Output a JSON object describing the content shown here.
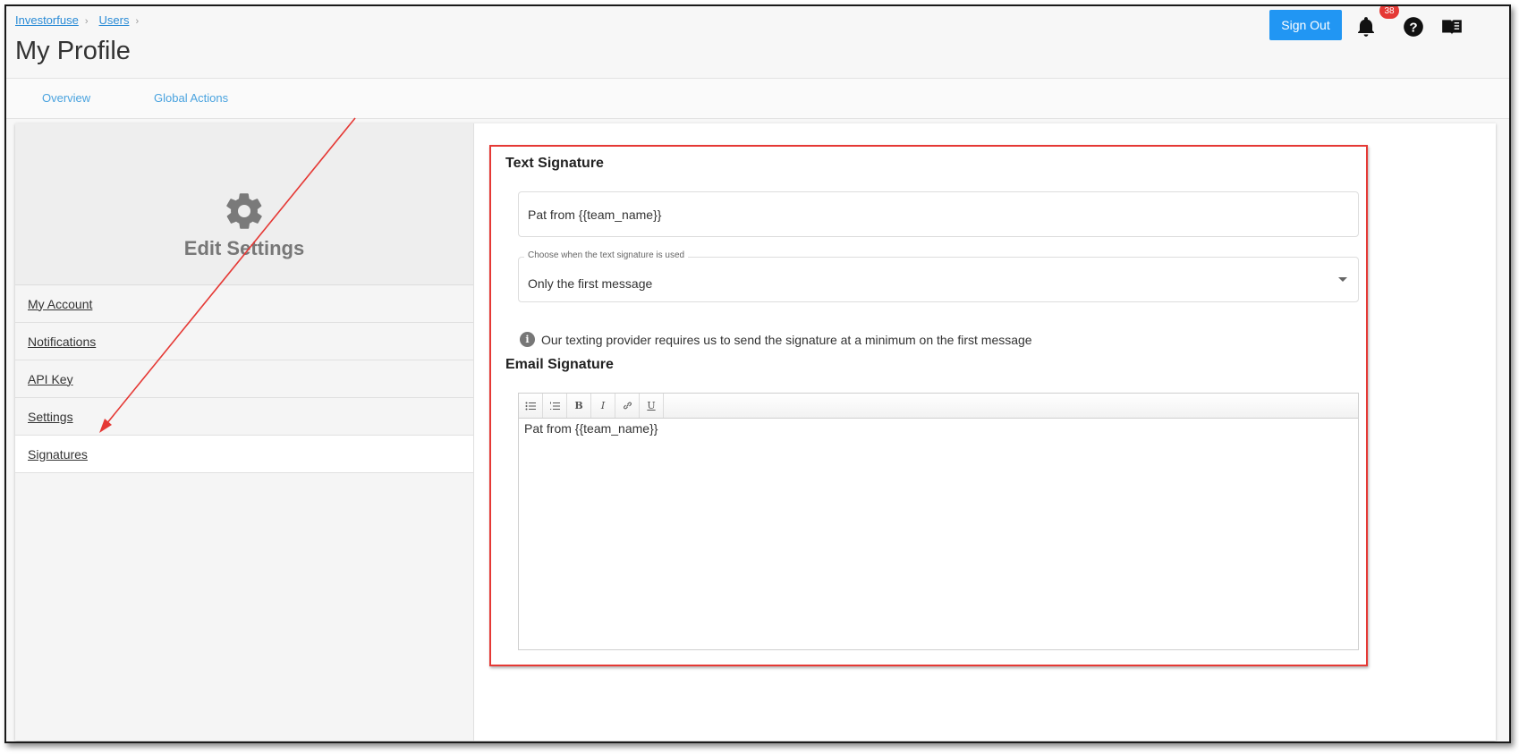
{
  "breadcrumb": [
    {
      "label": "Investorfuse"
    },
    {
      "label": "Users"
    }
  ],
  "header": {
    "title": "My Profile",
    "sign_out_label": "Sign Out",
    "notification_count": "38",
    "icons": [
      "bell-icon",
      "help-icon",
      "book-icon"
    ]
  },
  "tabs": [
    {
      "label": "Overview"
    },
    {
      "label": "Global Actions"
    }
  ],
  "sidebar": {
    "title": "Edit Settings",
    "items": [
      {
        "label": "My Account"
      },
      {
        "label": "Notifications"
      },
      {
        "label": "API Key"
      },
      {
        "label": "Settings"
      },
      {
        "label": "Signatures"
      }
    ],
    "active": "Signatures"
  },
  "text_signature": {
    "heading": "Text Signature",
    "value": "Pat from {{team_name}}",
    "select_label": "Choose when the text signature is used",
    "select_value": "Only the first message",
    "info": "Our texting provider requires us to send the signature at a minimum on the first message"
  },
  "email_signature": {
    "heading": "Email Signature",
    "toolbar": [
      "bullet-list",
      "numbered-list",
      "bold",
      "italic",
      "link",
      "underline"
    ],
    "body": "Pat from {{team_name}}"
  },
  "colors": {
    "accent": "#2196f3",
    "highlight": "#e53935",
    "link": "#2a8bd6"
  }
}
